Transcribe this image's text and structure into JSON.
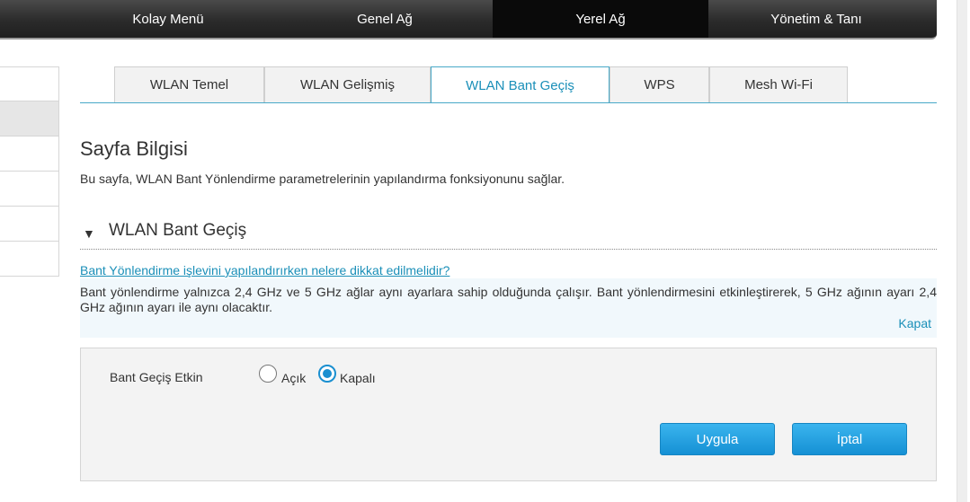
{
  "topnav": {
    "items": [
      {
        "label": "Kolay Menü"
      },
      {
        "label": "Genel Ağ"
      },
      {
        "label": "Yerel Ağ"
      },
      {
        "label": "Yönetim & Tanı"
      }
    ],
    "active": "Yerel Ağ"
  },
  "tabs": [
    {
      "label": "WLAN Temel"
    },
    {
      "label": "WLAN Gelişmiş"
    },
    {
      "label": "WLAN Bant Geçiş"
    },
    {
      "label": "WPS"
    },
    {
      "label": "Mesh Wi-Fi"
    }
  ],
  "active_tab": "WLAN Bant Geçiş",
  "page": {
    "title": "Sayfa Bilgisi",
    "description": "Bu sayfa, WLAN Bant Yönlendirme parametrelerinin yapılandırma fonksiyonunu sağlar."
  },
  "section": {
    "title": "WLAN Bant Geçiş",
    "help_link": "Bant Yönlendirme işlevini yapılandırırken nelere dikkat edilmelidir?",
    "help_text": "Bant yönlendirme yalnızca 2,4 GHz ve 5 GHz ağlar aynı ayarlara sahip olduğunda çalışır. Bant yönlendirmesini etkinleştirerek, 5 GHz ağının ayarı 2,4 GHz ağının ayarı ile aynı olacaktır.",
    "help_close": "Kapat"
  },
  "form": {
    "band_steering_label": "Bant Geçiş Etkin",
    "option_on": "Açık",
    "option_off": "Kapalı",
    "selected": "Kapalı",
    "apply_label": "Uygula",
    "cancel_label": "İptal"
  }
}
